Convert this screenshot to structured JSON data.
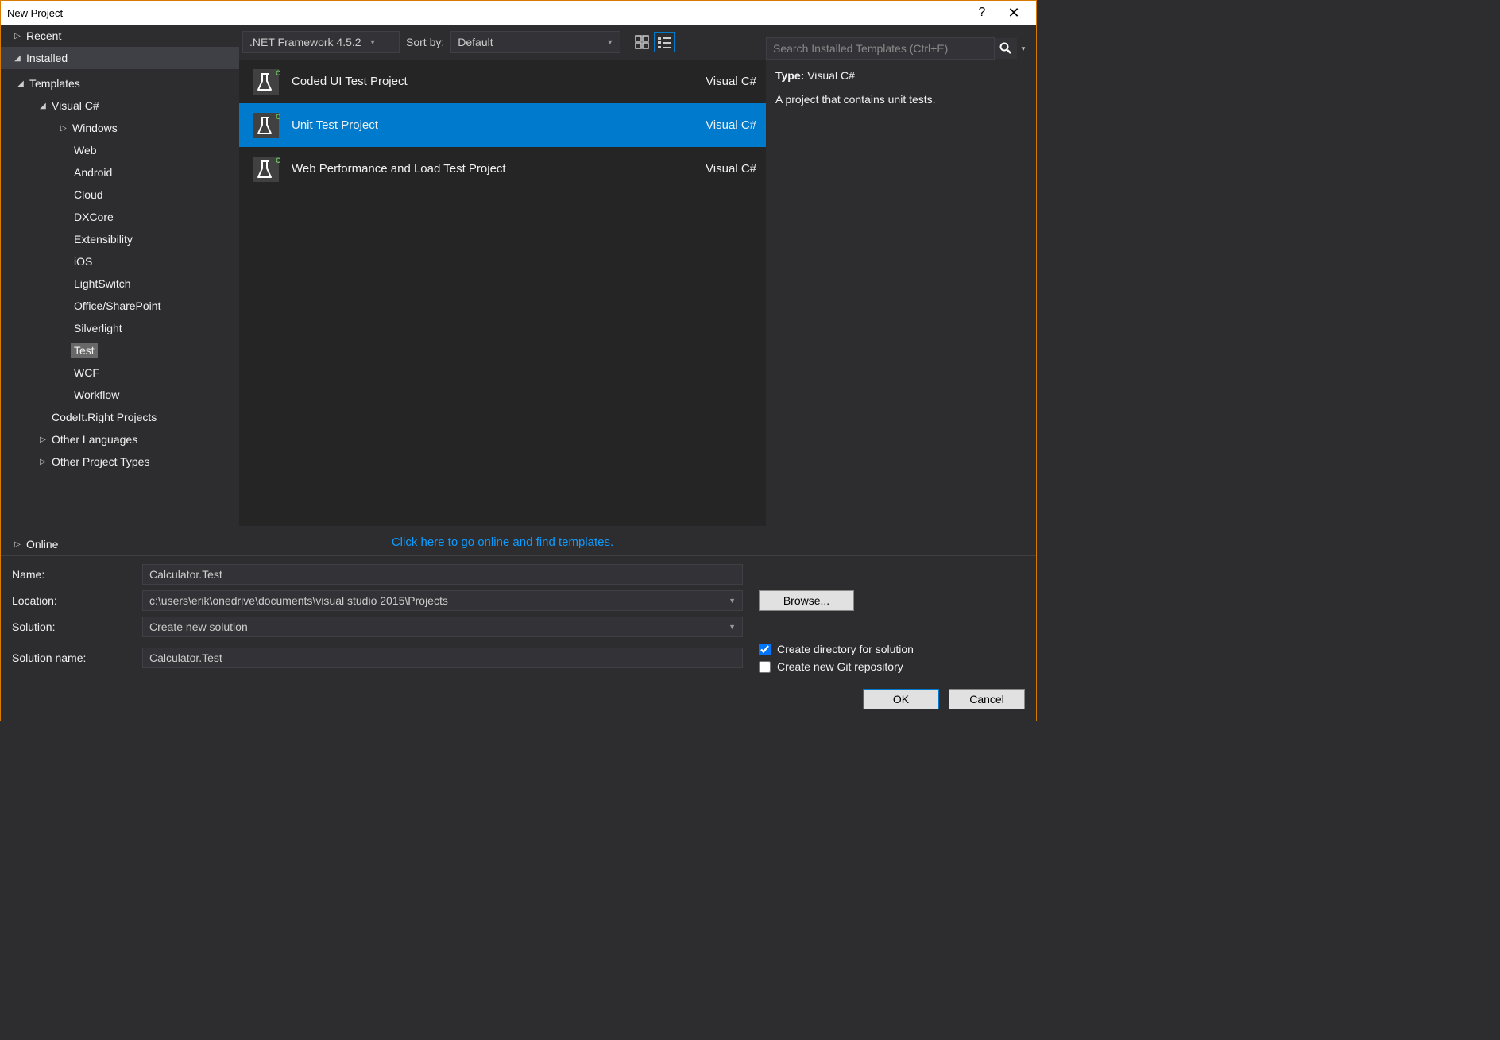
{
  "window": {
    "title": "New Project"
  },
  "sidebar": {
    "recent": "Recent",
    "installed": "Installed",
    "online": "Online",
    "tree": {
      "templates": "Templates",
      "visualcs": "Visual C#",
      "windows": "Windows",
      "web": "Web",
      "android": "Android",
      "cloud": "Cloud",
      "dxcore": "DXCore",
      "extensibility": "Extensibility",
      "ios": "iOS",
      "lightswitch": "LightSwitch",
      "office": "Office/SharePoint",
      "silverlight": "Silverlight",
      "test": "Test",
      "wcf": "WCF",
      "workflow": "Workflow",
      "codeit": "CodeIt.Right Projects",
      "otherlang": "Other Languages",
      "otherproj": "Other Project Types"
    }
  },
  "toolbar": {
    "framework": ".NET Framework 4.5.2",
    "sortby_label": "Sort by:",
    "sortby_value": "Default"
  },
  "search": {
    "placeholder": "Search Installed Templates (Ctrl+E)"
  },
  "templates": [
    {
      "name": "Coded UI Test Project",
      "lang": "Visual C#"
    },
    {
      "name": "Unit Test Project",
      "lang": "Visual C#"
    },
    {
      "name": "Web Performance and Load Test Project",
      "lang": "Visual C#"
    }
  ],
  "selected_template_index": 1,
  "description": {
    "type_label": "Type:",
    "type_value": "Visual C#",
    "text": "A project that contains unit tests."
  },
  "link": {
    "text": "Click here to go online and find templates."
  },
  "form": {
    "name_label": "Name:",
    "name_value": "Calculator.Test",
    "location_label": "Location:",
    "location_value": "c:\\users\\erik\\onedrive\\documents\\visual studio 2015\\Projects",
    "solution_label": "Solution:",
    "solution_value": "Create new solution",
    "solutionname_label": "Solution name:",
    "solutionname_value": "Calculator.Test",
    "browse": "Browse...",
    "check_dir": "Create directory for solution",
    "check_git": "Create new Git repository",
    "ok": "OK",
    "cancel": "Cancel"
  }
}
